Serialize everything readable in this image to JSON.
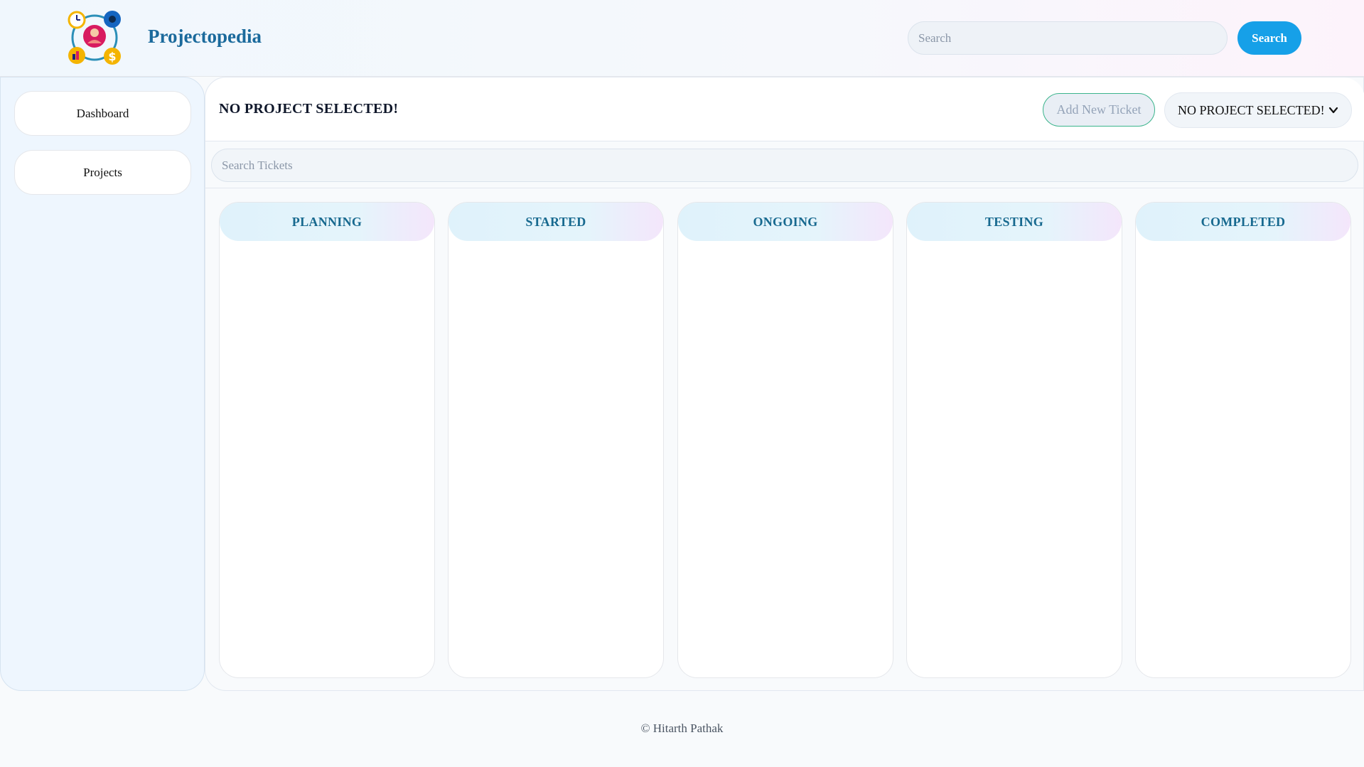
{
  "header": {
    "brand": "Projectopedia",
    "search_placeholder": "Search",
    "search_button": "Search"
  },
  "sidebar": {
    "items": [
      {
        "label": "Dashboard"
      },
      {
        "label": "Projects"
      }
    ]
  },
  "main": {
    "project_title": "NO PROJECT SELECTED!",
    "add_ticket_label": "Add New Ticket",
    "project_select_value": "NO PROJECT SELECTED!",
    "ticket_search_placeholder": "Search Tickets",
    "columns": [
      {
        "title": "PLANNING"
      },
      {
        "title": "STARTED"
      },
      {
        "title": "ONGOING"
      },
      {
        "title": "TESTING"
      },
      {
        "title": "COMPLETED"
      }
    ]
  },
  "footer": {
    "copyright": "© Hitarth Pathak"
  },
  "colors": {
    "accent": "#16a0e8",
    "brand": "#1b6a9c",
    "column_header": "#17698f"
  }
}
